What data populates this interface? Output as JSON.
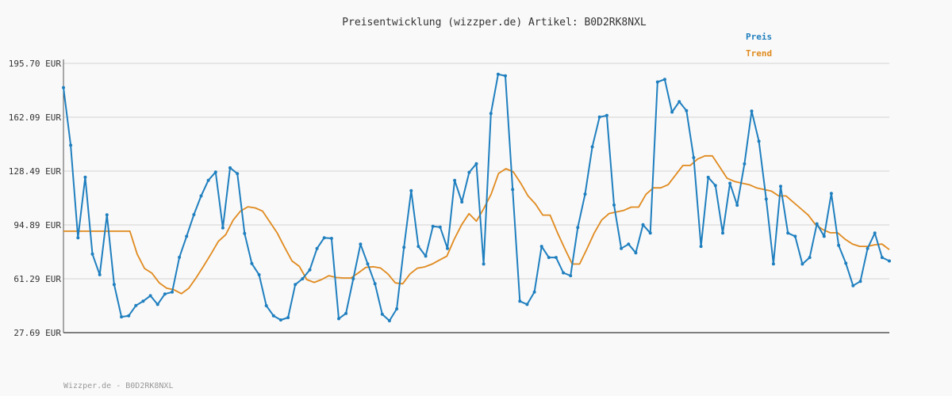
{
  "chart_data": {
    "type": "line",
    "title": "Preisentwicklung (wizzper.de) Artikel: B0D2RK8NXL",
    "footer": "Wizzper.de - B0D2RK8NXL",
    "yticks": [
      "195.70 EUR",
      "162.09 EUR",
      "128.49 EUR",
      "94.89 EUR",
      "61.29 EUR",
      "27.69 EUR"
    ],
    "ylim": [
      27.69,
      195.7
    ],
    "grid": true,
    "legend_position": "top-right",
    "colors": {
      "preis": "#1f7fbf",
      "trend": "#e08a1e",
      "grid": "#e0e0e0",
      "axis": "#555555"
    },
    "series": [
      {
        "name": "Preis",
        "values": [
          180.6,
          144.6,
          86.9,
          124.7,
          76.7,
          63.8,
          101.2,
          57.7,
          37.5,
          38.2,
          44.6,
          47.3,
          50.7,
          45.3,
          51.8,
          53.0,
          74.7,
          87.8,
          101.3,
          113.0,
          122.7,
          127.9,
          93.0,
          130.5,
          126.9,
          89.6,
          70.8,
          63.8,
          44.5,
          38.2,
          35.6,
          37.1,
          57.7,
          61.3,
          66.9,
          80.2,
          86.9,
          86.5,
          36.4,
          39.7,
          61.3,
          82.9,
          70.6,
          58.2,
          39.2,
          35.1,
          42.5,
          80.9,
          116.3,
          81.5,
          75.4,
          94.0,
          93.5,
          80.2,
          122.7,
          109.2,
          127.7,
          133.1,
          70.5,
          164.4,
          188.9,
          187.9,
          117.0,
          47.3,
          45.3,
          53.0,
          81.5,
          74.6,
          74.6,
          65.0,
          63.2,
          93.3,
          114.1,
          143.6,
          162.2,
          163.2,
          107.3,
          80.2,
          82.9,
          77.5,
          95.0,
          89.8,
          184.1,
          185.7,
          165.3,
          171.8,
          166.2,
          136.9,
          81.5,
          124.6,
          119.5,
          89.8,
          120.9,
          107.2,
          133.0,
          165.9,
          147.1,
          111.0,
          70.6,
          119.0,
          89.8,
          87.8,
          70.5,
          74.6,
          95.6,
          87.8,
          114.5,
          82.2,
          71.0,
          57.0,
          59.7,
          80.2,
          89.8,
          74.6,
          72.4
        ]
      },
      {
        "name": "Trend",
        "values": [
          91.0,
          91.0,
          91.0,
          91.0,
          91.0,
          91.0,
          91.0,
          91.0,
          91.0,
          91.0,
          76.7,
          67.7,
          64.8,
          58.7,
          55.4,
          54.4,
          52.0,
          55.4,
          62.0,
          69.2,
          76.7,
          84.6,
          88.8,
          97.8,
          103.5,
          106.2,
          105.5,
          103.5,
          96.6,
          89.8,
          80.9,
          72.4,
          69.0,
          60.8,
          59.0,
          60.8,
          63.2,
          62.1,
          61.8,
          61.8,
          65.0,
          68.4,
          68.8,
          68.0,
          64.3,
          58.7,
          58.2,
          64.3,
          67.9,
          68.7,
          70.5,
          73.0,
          75.4,
          86.0,
          95.0,
          101.9,
          97.2,
          105.1,
          114.1,
          127.0,
          130.0,
          128.0,
          121.0,
          113.0,
          108.0,
          101.0,
          101.0,
          90.0,
          80.0,
          70.5,
          70.5,
          80.0,
          90.0,
          98.0,
          102.0,
          103.0,
          104.0,
          106.0,
          106.0,
          114.0,
          118.0,
          118.0,
          120.0,
          126.0,
          132.0,
          132.0,
          136.0,
          138.0,
          138.0,
          131.0,
          124.0,
          122.0,
          121.0,
          120.0,
          118.0,
          117.0,
          116.0,
          113.0,
          113.0,
          109.0,
          105.0,
          101.0,
          95.0,
          92.0,
          90.0,
          90.0,
          86.0,
          83.0,
          81.5,
          81.5,
          82.5,
          83.0,
          79.5
        ]
      }
    ]
  }
}
